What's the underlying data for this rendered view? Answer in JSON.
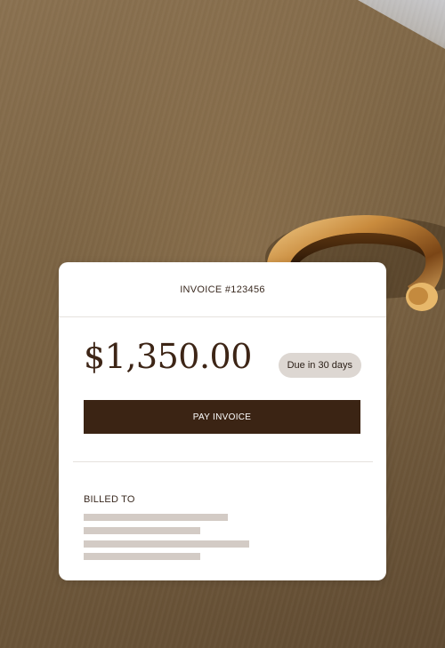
{
  "invoice": {
    "title": "INVOICE #123456",
    "amount": "$1,350.00",
    "due_badge": "Due in 30 days",
    "pay_button_label": "PAY INVOICE",
    "billed_to_label": "BILLED TO"
  },
  "colors": {
    "brand_dark": "#3b2414",
    "badge_bg": "#ddd7d2",
    "placeholder": "#d3cbc5",
    "card_bg": "#ffffff"
  }
}
